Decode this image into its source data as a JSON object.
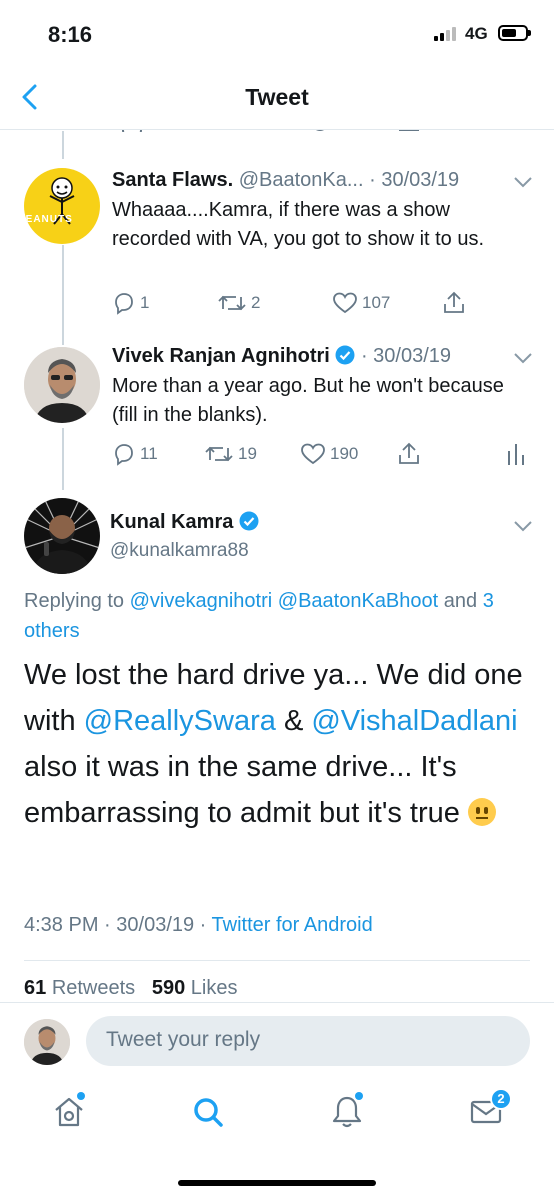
{
  "status_bar": {
    "time": "8:16",
    "network": "4G"
  },
  "nav": {
    "title": "Tweet"
  },
  "replies": [
    {
      "name": "Santa Flaws.",
      "handle": "@BaatonKa...",
      "date": "· 30/03/19",
      "text": "Whaaaa....Kamra, if there was a show recorded with VA, you got to show it to us.",
      "avatar_text": "PEANUTS",
      "reply_count": "1",
      "retweet_count": "2",
      "like_count": "107"
    },
    {
      "name": "Vivek Ranjan Agnihotri",
      "verified": true,
      "date": "· 30/03/19",
      "text": "More than a year ago. But he won't because (fill in the blanks).",
      "reply_count": "11",
      "retweet_count": "19",
      "like_count": "190"
    }
  ],
  "main_tweet": {
    "name": "Kunal Kamra",
    "verified": true,
    "handle": "@kunalkamra88",
    "replying_prefix": "Replying to",
    "replying_to_1": "@vivekagnihotri",
    "replying_to_2": "@BaatonKaBhoot",
    "replying_and": "and",
    "replying_others": "3 others",
    "text_1": "We lost the hard drive ya... We did one with",
    "mention_1": "@ReallySwara",
    "text_2": "&",
    "mention_2": "@VishalDadlani",
    "text_3": "also it was in the same drive... It's embarrassing to admit but it's true",
    "emoji": "neutral-face-emoji",
    "time": "4:38 PM",
    "date": "· 30/03/19 ·",
    "source": "Twitter for Android",
    "retweets_count": "61",
    "retweets_label": "Retweets",
    "likes_count": "590",
    "likes_label": "Likes"
  },
  "reply_bar": {
    "placeholder": "Tweet your reply"
  },
  "tab_bar": {
    "items": [
      "home-icon",
      "search-icon",
      "notifications-icon",
      "messages-icon"
    ],
    "messages_badge": "2"
  },
  "colors": {
    "accent": "#1da1f2",
    "link": "#1b95e0",
    "muted": "#657786"
  }
}
